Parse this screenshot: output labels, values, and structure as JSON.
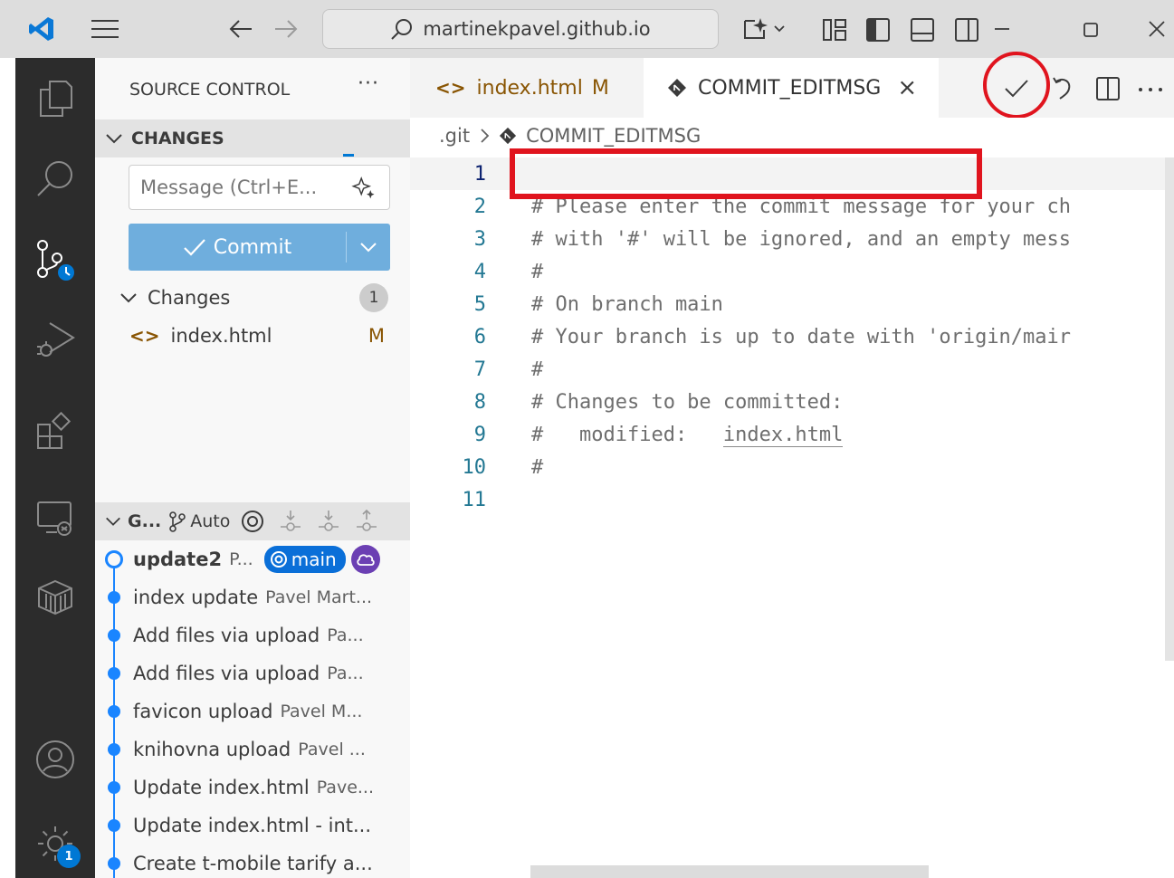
{
  "titlebar": {
    "search_text": "martinekpavel.github.io"
  },
  "sidebar": {
    "title": "SOURCE CONTROL",
    "more": "···",
    "changes_header": "CHANGES",
    "message_placeholder": "Message (Ctrl+E...",
    "commit_label": "Commit",
    "changes_group": "Changes",
    "changes_count": "1",
    "file_name": "index.html",
    "file_status": "M",
    "graph_header": "G...",
    "graph_auto": "Auto",
    "graph": [
      {
        "msg": "update2",
        "author": "P...",
        "head": true
      },
      {
        "msg": "index update",
        "author": "Pavel Mart..."
      },
      {
        "msg": "Add files via upload",
        "author": "Pa..."
      },
      {
        "msg": "Add files via upload",
        "author": "Pa..."
      },
      {
        "msg": "favicon upload",
        "author": "Pavel M..."
      },
      {
        "msg": "knihovna upload",
        "author": "Pavel ..."
      },
      {
        "msg": "Update index.html",
        "author": "Pave..."
      },
      {
        "msg": "Update index.html - int...",
        "author": ""
      },
      {
        "msg": "Create t-mobile tarify a...",
        "author": ""
      }
    ],
    "branch_badge": "main"
  },
  "activitybar": {
    "settings_badge": "1"
  },
  "tabs": [
    {
      "label": "index.html",
      "status": "M"
    },
    {
      "label": "COMMIT_EDITMSG",
      "close": "×"
    }
  ],
  "breadcrumbs": {
    "folder": ".git",
    "file": "COMMIT_EDITMSG"
  },
  "editor": {
    "lines": [
      {
        "n": "1",
        "text": ""
      },
      {
        "n": "2",
        "text": "# Please enter the commit message for your ch"
      },
      {
        "n": "3",
        "text": "# with '#' will be ignored, and an empty mess"
      },
      {
        "n": "4",
        "text": "#"
      },
      {
        "n": "5",
        "text": "# On branch main"
      },
      {
        "n": "6",
        "text": "# Your branch is up to date with 'origin/mair"
      },
      {
        "n": "7",
        "text": "#"
      },
      {
        "n": "8",
        "text": "# Changes to be committed:"
      },
      {
        "n": "9",
        "text": "#   modified:   ",
        "link": "index.html"
      },
      {
        "n": "10",
        "text": "#"
      },
      {
        "n": "11",
        "text": ""
      }
    ]
  },
  "colors": {
    "accent": "#0078d4",
    "annotation": "#e0141e",
    "modified": "#895503"
  }
}
